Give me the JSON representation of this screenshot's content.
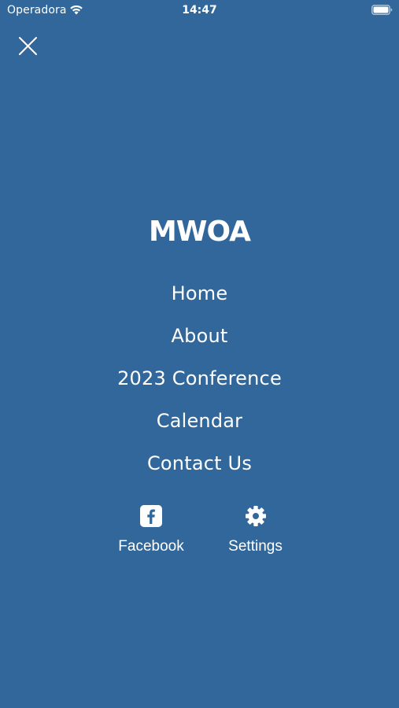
{
  "status_bar": {
    "carrier": "Operadora",
    "time": "14:47"
  },
  "menu": {
    "brand": "MWOA",
    "items": [
      {
        "label": "Home"
      },
      {
        "label": "About"
      },
      {
        "label": "2023 Conference"
      },
      {
        "label": "Calendar"
      },
      {
        "label": "Contact Us"
      }
    ]
  },
  "social": {
    "facebook_label": "Facebook",
    "settings_label": "Settings"
  },
  "colors": {
    "background": "#31679a",
    "foreground": "#ffffff"
  }
}
